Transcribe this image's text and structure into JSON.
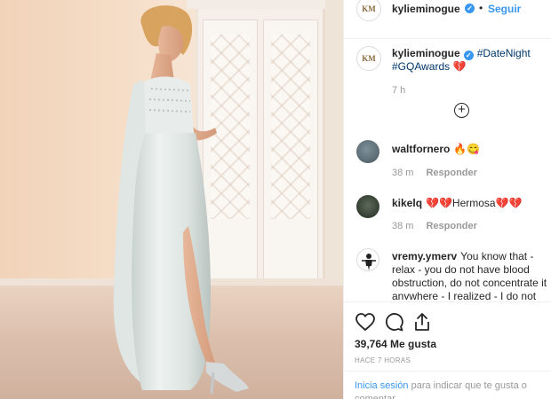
{
  "post": {
    "username": "kylieminogue",
    "follow_label": "Seguir",
    "separator": "•",
    "avatar_text": "KM",
    "caption": {
      "username": "kylieminogue",
      "hashtag1": "#DateNight",
      "hashtag2": "#GQAwards",
      "emoji": "💔"
    },
    "caption_time": "7 h",
    "load_more_icon": "plus-circle-icon"
  },
  "comments": [
    {
      "username": "waltfornero",
      "text": "🔥😋",
      "time": "38 m",
      "reply": "Responder"
    },
    {
      "username": "kikelq",
      "text": "💔💔Hermosa💔💔",
      "time": "38 m",
      "reply": "Responder"
    },
    {
      "username": "vremy.ymerv",
      "text": "You know that - relax - you do not have blood obstruction, do not concentrate it anywhere - I realized - I do not accidentally worry"
    }
  ],
  "actions": {
    "like_icon": "heart-icon",
    "comment_icon": "comment-icon",
    "share_icon": "share-icon",
    "likes": "39,764 Me gusta",
    "posted_ago": "HACE 7 HORAS"
  },
  "login": {
    "link": "Inicia sesión",
    "text": " para indicar que te gusta o comentar."
  },
  "colors": {
    "link_blue": "#3897f0",
    "hashtag_blue": "#003569",
    "muted": "#999999",
    "verified": "#3897f0"
  }
}
